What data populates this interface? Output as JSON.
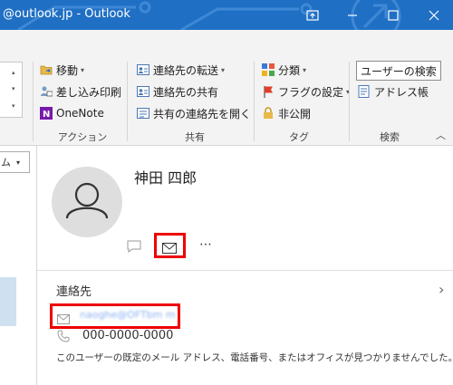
{
  "titlebar": {
    "title": "@outlook.jp  -  Outlook",
    "bg_color": "#1f6fc4",
    "buttons": [
      "restore-icon",
      "minimize-icon",
      "maximize-icon",
      "close-icon"
    ]
  },
  "ribbon": {
    "groups": [
      {
        "label": "アクション",
        "items": [
          {
            "label": "移動",
            "icon": "move-folder-icon",
            "dropdown": true
          },
          {
            "label": "差し込み印刷",
            "icon": "mail-merge-icon"
          },
          {
            "label": "OneNote",
            "icon": "onenote-icon"
          }
        ]
      },
      {
        "label": "共有",
        "items": [
          {
            "label": "連絡先の転送",
            "icon": "forward-contact-icon",
            "dropdown": true
          },
          {
            "label": "連絡先の共有",
            "icon": "share-contact-icon"
          },
          {
            "label": "共有の連絡先を開く",
            "icon": "open-shared-contacts-icon"
          }
        ]
      },
      {
        "label": "タグ",
        "items": [
          {
            "label": "分類",
            "icon": "categorize-icon",
            "dropdown": true
          },
          {
            "label": "フラグの設定",
            "icon": "flag-icon",
            "dropdown": true
          },
          {
            "label": "非公開",
            "icon": "lock-icon"
          }
        ]
      },
      {
        "label": "検索",
        "items": [
          {
            "label": "ユーザーの検索",
            "icon": "find-user-icon"
          },
          {
            "label": "アドレス帳",
            "icon": "address-book-icon"
          }
        ]
      }
    ]
  },
  "left_pane": {
    "dropdown_text": "ム"
  },
  "contact": {
    "name": "神田 四郎",
    "section_title": "連絡先",
    "email": "naoghe@OFTbm m",
    "phone": "000-0000-0000",
    "notice": "このユーザーの既定のメール アドレス、電話番号、またはオフィスが見つかりませんでした。",
    "highlight_color": "#e00000"
  }
}
